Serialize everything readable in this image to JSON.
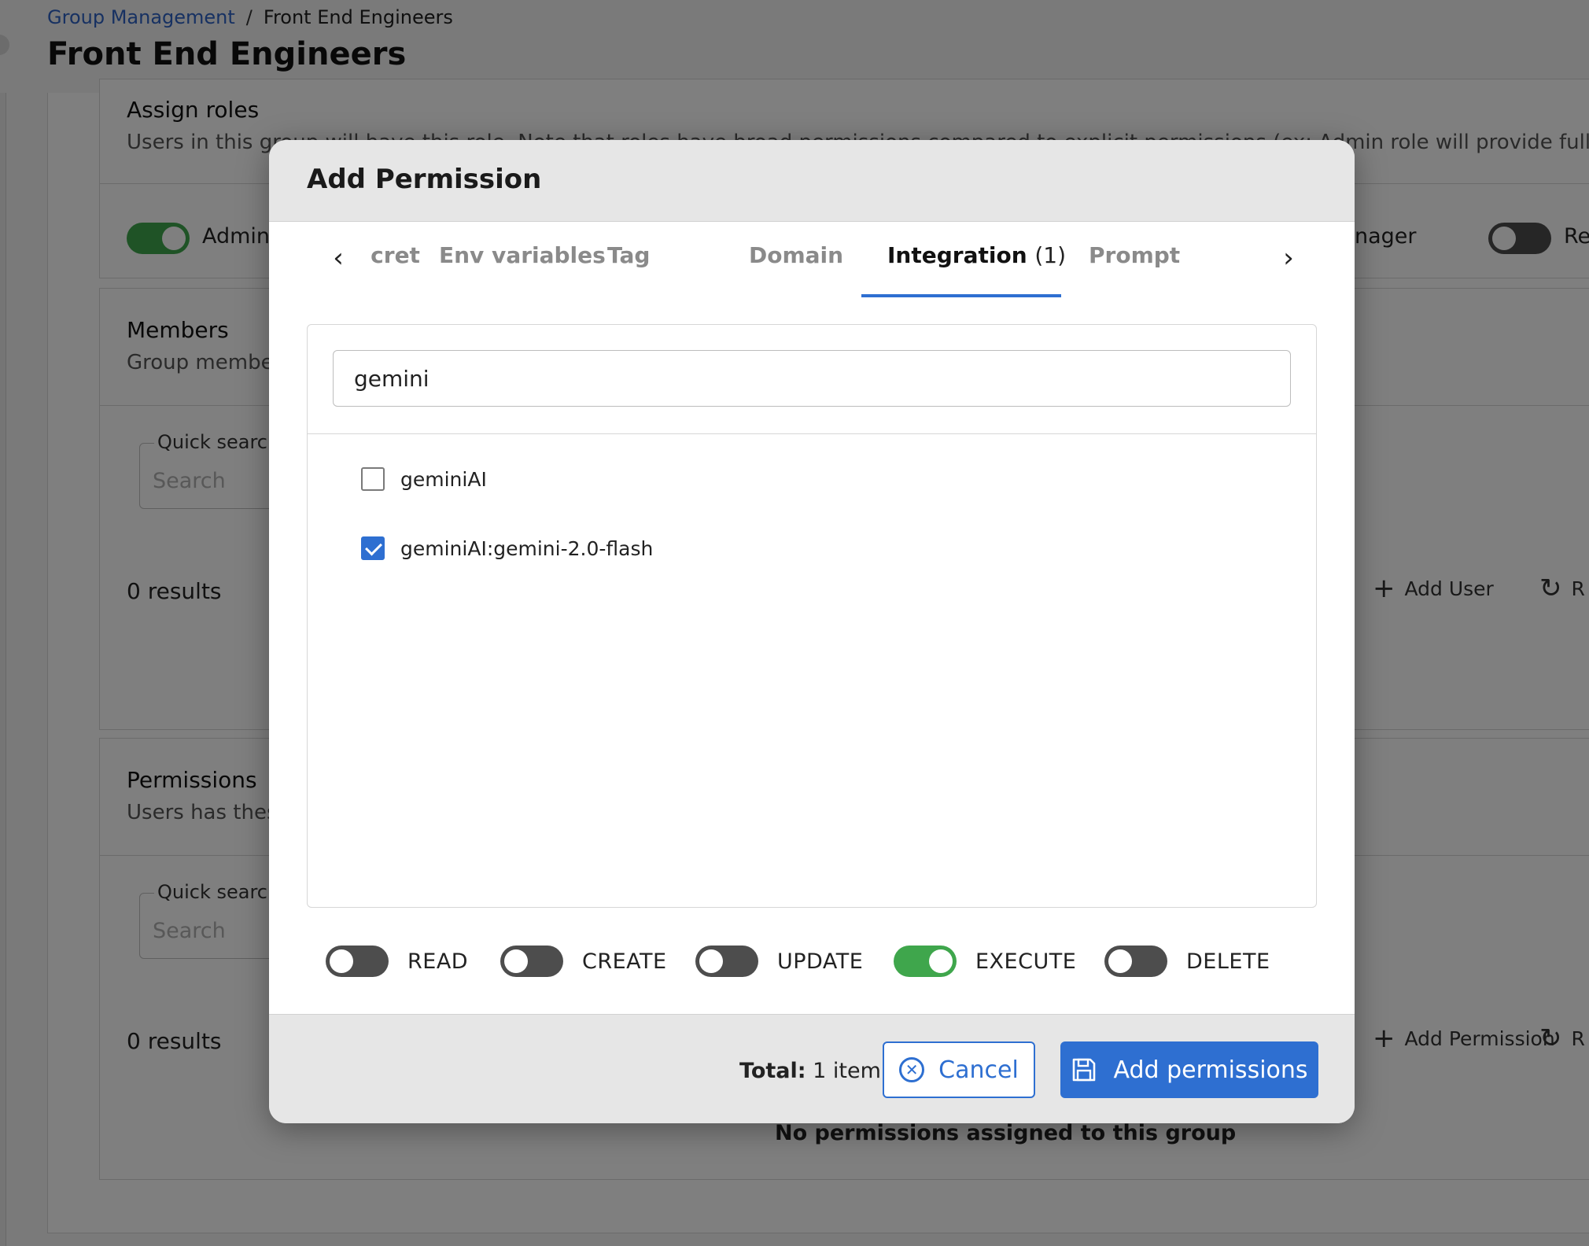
{
  "breadcrumb": {
    "parent": "Group Management",
    "separator": "/",
    "current": "Front End Engineers"
  },
  "page_title": "Front End Engineers",
  "background": {
    "assign_roles": {
      "title": "Assign roles",
      "subtitle": "Users in this group will have this role. Note that roles have broad permissions compared to explicit permissions (ex: Admin role will provide full administra",
      "roles": [
        {
          "label": "Admin",
          "on": true
        },
        {
          "label": "Metadata Manager",
          "on": false
        },
        {
          "label": "Read Only",
          "on": false
        }
      ],
      "visible_fragments": {
        "manager": "nager",
        "read": "Re"
      }
    },
    "members": {
      "title": "Members",
      "subtitle": "Group members",
      "quick_search_label": "Quick search",
      "search_placeholder": "Search",
      "results": "0 results",
      "add_label": "Add User",
      "refresh_label": "R"
    },
    "permissions": {
      "title": "Permissions",
      "subtitle": "Users has these permissions",
      "quick_search_label": "Quick search",
      "search_placeholder": "Search",
      "results": "0 results",
      "add_label": "Add Permission",
      "refresh_label": "R",
      "empty_message": "No permissions assigned to this group"
    }
  },
  "modal": {
    "title": "Add Permission",
    "tabs": [
      {
        "label": "Secret",
        "count": ""
      },
      {
        "label": "Env variables",
        "count": ""
      },
      {
        "label": "Tag",
        "count": ""
      },
      {
        "label": "Domain",
        "count": ""
      },
      {
        "label": "Integration",
        "count": "(1)",
        "active": true
      },
      {
        "label": "Prompt",
        "count": ""
      }
    ],
    "search_value": "gemini",
    "items": [
      {
        "label": "geminiAI",
        "checked": false
      },
      {
        "label": "geminiAI:gemini-2.0-flash",
        "checked": true
      }
    ],
    "permissions": [
      {
        "label": "READ",
        "on": false
      },
      {
        "label": "CREATE",
        "on": false
      },
      {
        "label": "UPDATE",
        "on": false
      },
      {
        "label": "EXECUTE",
        "on": true
      },
      {
        "label": "DELETE",
        "on": false
      }
    ],
    "footer": {
      "total_label": "Total:",
      "total_value": "1 item",
      "cancel_label": "Cancel",
      "add_label": "Add permissions"
    }
  },
  "colors": {
    "accent": "#2e6fd1",
    "toggle_on": "#3fa64c",
    "toggle_off": "#4d4d4d",
    "link": "#2e63c4"
  },
  "icons": [
    "chevron-left-icon",
    "chevron-right-icon",
    "checkbox-icon",
    "cancel-circle-icon",
    "save-icon",
    "plus-icon",
    "refresh-icon"
  ]
}
